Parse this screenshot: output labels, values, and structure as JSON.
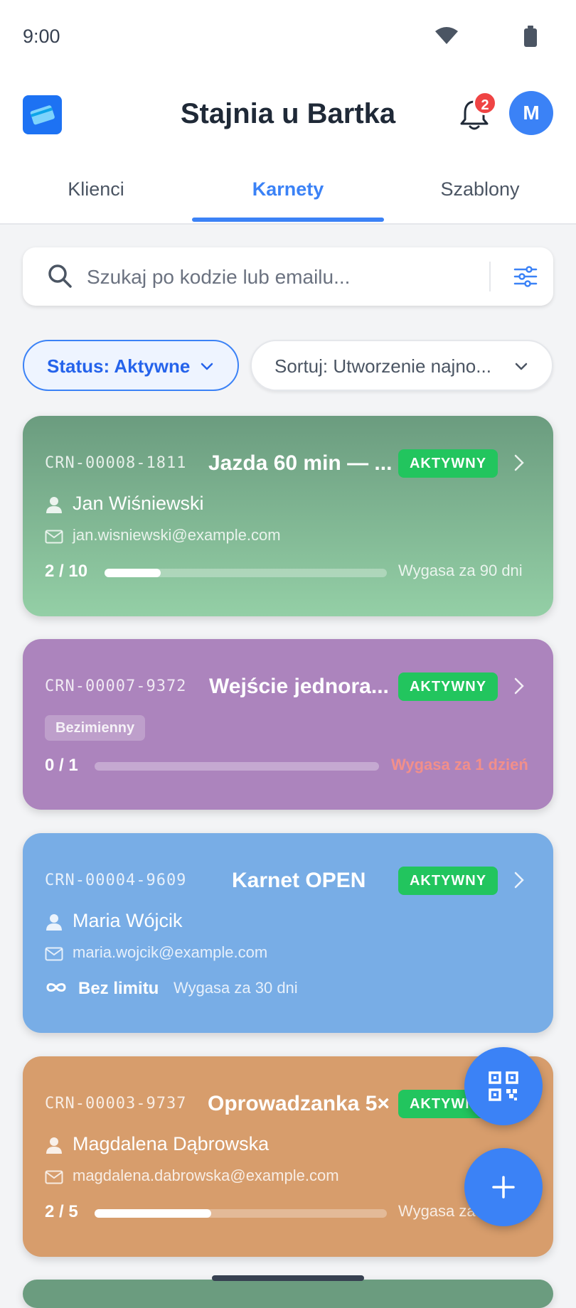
{
  "status_bar": {
    "time": "9:00"
  },
  "app": {
    "title": "Stajnia u Bartka",
    "notification_count": "2",
    "avatar_initial": "M"
  },
  "tabs": [
    {
      "label": "Klienci",
      "active": false
    },
    {
      "label": "Karnety",
      "active": true
    },
    {
      "label": "Szablony",
      "active": false
    }
  ],
  "search": {
    "placeholder": "Szukaj po kodzie lub emailu..."
  },
  "filters": {
    "status_label": "Status: Aktywne",
    "sort_label": "Sortuj: Utworzenie najno..."
  },
  "passes": [
    {
      "code": "CRN-00008-1811",
      "name": "Jazda 60 min — ...",
      "status": "AKTYWNY",
      "client": "Jan Wiśniewski",
      "email": "jan.wisniewski@example.com",
      "usage": "2 / 10",
      "usage_fraction": 0.2,
      "expires": "Wygasa za 90 dni",
      "color": "#7fb391"
    },
    {
      "code": "CRN-00007-9372",
      "name": "Wejście jednora...",
      "status": "AKTYWNY",
      "anonymous_label": "Bezimienny",
      "usage": "0 / 1",
      "usage_fraction": 0,
      "expires": "Wygasa za 1 dzień",
      "color": "#ac84bd"
    },
    {
      "code": "CRN-00004-9609",
      "name": "Karnet OPEN",
      "status": "AKTYWNY",
      "client": "Maria Wójcik",
      "email": "maria.wojcik@example.com",
      "usage": "Bez limitu",
      "expires": "Wygasa za 30 dni",
      "color": "#78ade6"
    },
    {
      "code": "CRN-00003-9737",
      "name": "Oprowadzanka 5×",
      "status": "AKTYWNY",
      "client": "Magdalena Dąbrowska",
      "email": "magdalena.dabrowska@example.com",
      "usage": "2 / 5",
      "usage_fraction": 0.4,
      "expires": "Wygasa za 30 dni",
      "color": "#d79d6c"
    }
  ],
  "colors": {
    "accent": "#3b82f6",
    "status_active": "#22c55e",
    "warning_text": "#f28f8a"
  },
  "icons": [
    "logo-icon",
    "bell-icon",
    "search-icon",
    "filter-icon",
    "chevron-down-icon",
    "chevron-right-icon",
    "person-icon",
    "mail-icon",
    "infinity-icon",
    "qr-code-icon",
    "plus-icon"
  ]
}
